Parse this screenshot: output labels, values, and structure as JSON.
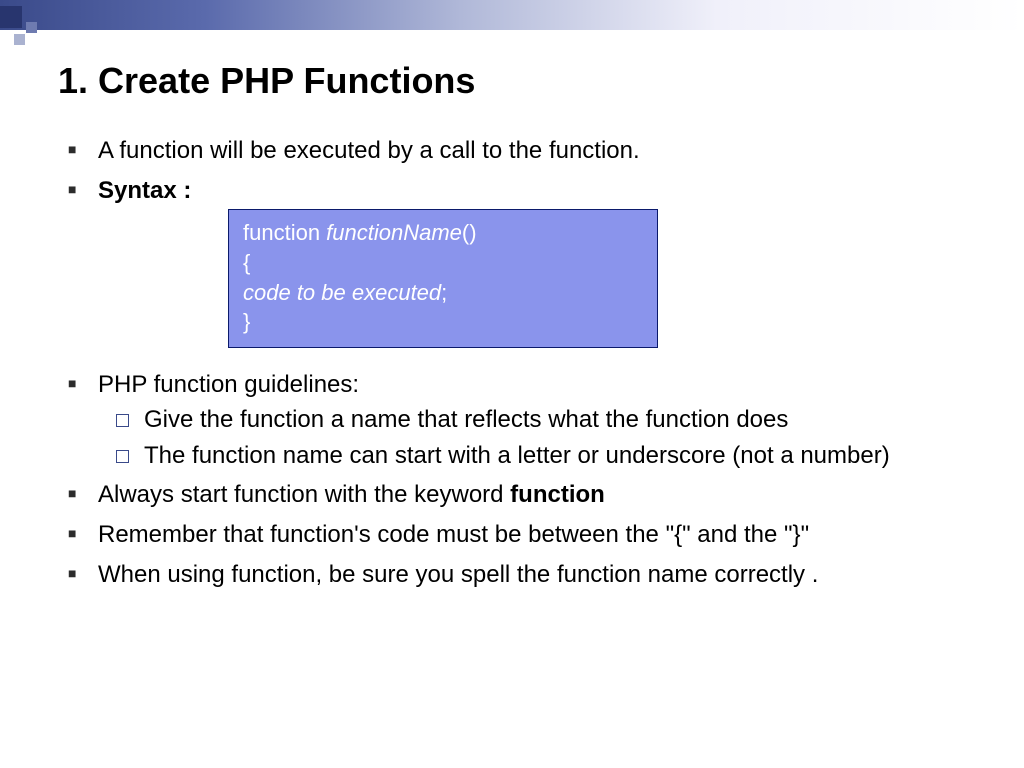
{
  "header": {
    "title": "1. Create PHP Functions"
  },
  "bullets": {
    "b1": "A function will be executed by a call to the function.",
    "b2": "Syntax :",
    "b3": " PHP function guidelines:",
    "b3_sub1": "Give the function a name that reflects what the function does",
    "b3_sub2": "The function name can start with a letter or underscore (not a number)",
    "b4_pre": "Always start  function with the keyword ",
    "b4_bold": "function",
    "b5": "Remember that function's code must be between the \"{\" and the \"}\"",
    "b6": "When using function, be sure you spell the function name correctly ."
  },
  "code": {
    "line1_kw": "function ",
    "line1_name": "functionName",
    "line1_paren": "()",
    "line2": "{",
    "line3_body": "code to be executed",
    "line3_semi": ";",
    "line4": "}"
  }
}
